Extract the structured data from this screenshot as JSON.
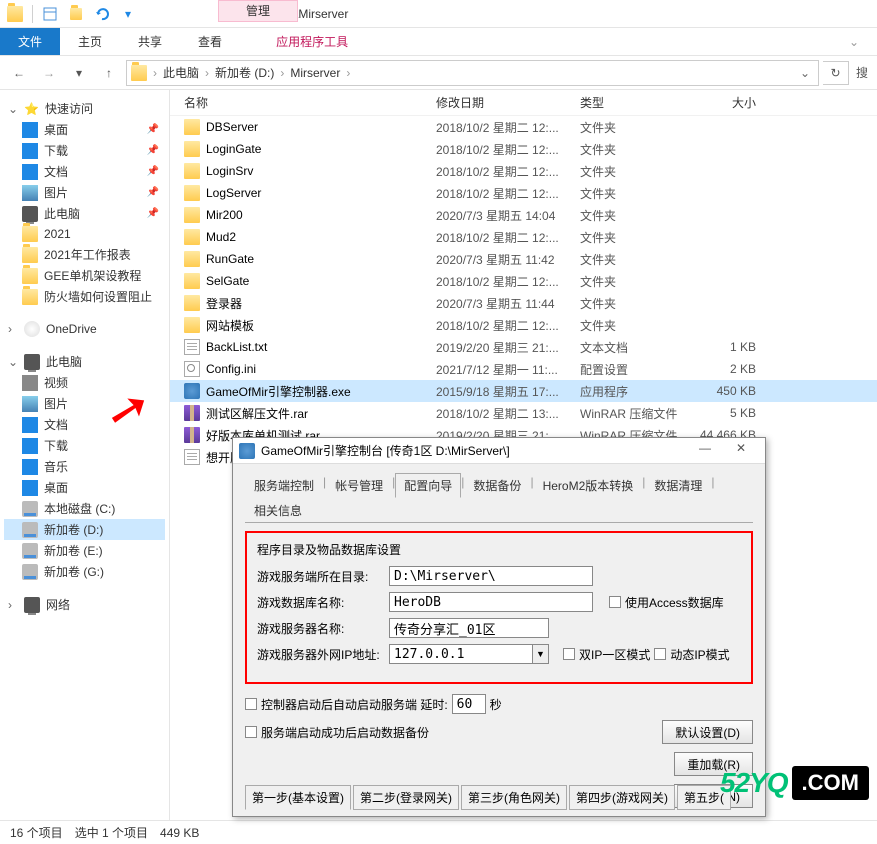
{
  "window": {
    "path_display": "D:\\Mirserver",
    "manage_tab": "管理"
  },
  "ribbon": {
    "file": "文件",
    "home": "主页",
    "share": "共享",
    "view": "查看",
    "apptools": "应用程序工具"
  },
  "breadcrumb": {
    "pc": "此电脑",
    "drive": "新加卷 (D:)",
    "folder": "Mirserver"
  },
  "search_placeholder": "搜",
  "columns": {
    "name": "名称",
    "date": "修改日期",
    "type": "类型",
    "size": "大小"
  },
  "sidebar": {
    "quick": {
      "label": "快速访问",
      "items": [
        {
          "label": "桌面",
          "icon": "blue",
          "pin": true
        },
        {
          "label": "下载",
          "icon": "blue",
          "pin": true
        },
        {
          "label": "文档",
          "icon": "blue",
          "pin": true
        },
        {
          "label": "图片",
          "icon": "pic",
          "pin": true
        },
        {
          "label": "此电脑",
          "icon": "pc",
          "pin": true
        },
        {
          "label": "2021",
          "icon": "folder"
        },
        {
          "label": "2021年工作报表",
          "icon": "folder"
        },
        {
          "label": "GEE单机架设教程",
          "icon": "folder"
        },
        {
          "label": "防火墙如何设置阻止",
          "icon": "folder"
        }
      ]
    },
    "onedrive": {
      "label": "OneDrive"
    },
    "thispc": {
      "label": "此电脑",
      "items": [
        {
          "label": "视频",
          "icon": "grey"
        },
        {
          "label": "图片",
          "icon": "pic"
        },
        {
          "label": "文档",
          "icon": "blue"
        },
        {
          "label": "下载",
          "icon": "blue"
        },
        {
          "label": "音乐",
          "icon": "blue"
        },
        {
          "label": "桌面",
          "icon": "blue"
        },
        {
          "label": "本地磁盘 (C:)",
          "icon": "disk"
        },
        {
          "label": "新加卷 (D:)",
          "icon": "disk",
          "sel": true
        },
        {
          "label": "新加卷 (E:)",
          "icon": "disk"
        },
        {
          "label": "新加卷 (G:)",
          "icon": "disk"
        }
      ]
    },
    "network": {
      "label": "网络"
    }
  },
  "files": [
    {
      "name": "DBServer",
      "date": "2018/10/2 星期二 12:...",
      "type": "文件夹",
      "size": "",
      "icon": "folder"
    },
    {
      "name": "LoginGate",
      "date": "2018/10/2 星期二 12:...",
      "type": "文件夹",
      "size": "",
      "icon": "folder"
    },
    {
      "name": "LoginSrv",
      "date": "2018/10/2 星期二 12:...",
      "type": "文件夹",
      "size": "",
      "icon": "folder"
    },
    {
      "name": "LogServer",
      "date": "2018/10/2 星期二 12:...",
      "type": "文件夹",
      "size": "",
      "icon": "folder"
    },
    {
      "name": "Mir200",
      "date": "2020/7/3 星期五 14:04",
      "type": "文件夹",
      "size": "",
      "icon": "folder"
    },
    {
      "name": "Mud2",
      "date": "2018/10/2 星期二 12:...",
      "type": "文件夹",
      "size": "",
      "icon": "folder"
    },
    {
      "name": "RunGate",
      "date": "2020/7/3 星期五 11:42",
      "type": "文件夹",
      "size": "",
      "icon": "folder"
    },
    {
      "name": "SelGate",
      "date": "2018/10/2 星期二 12:...",
      "type": "文件夹",
      "size": "",
      "icon": "folder"
    },
    {
      "name": "登录器",
      "date": "2020/7/3 星期五 11:44",
      "type": "文件夹",
      "size": "",
      "icon": "folder"
    },
    {
      "name": "网站模板",
      "date": "2018/10/2 星期二 12:...",
      "type": "文件夹",
      "size": "",
      "icon": "folder"
    },
    {
      "name": "BackList.txt",
      "date": "2019/2/20 星期三 21:...",
      "type": "文本文档",
      "size": "1 KB",
      "icon": "txt"
    },
    {
      "name": "Config.ini",
      "date": "2021/7/12 星期一 11:...",
      "type": "配置设置",
      "size": "2 KB",
      "icon": "ini"
    },
    {
      "name": "GameOfMir引擎控制器.exe",
      "date": "2015/9/18 星期五 17:...",
      "type": "应用程序",
      "size": "450 KB",
      "icon": "exe",
      "sel": true
    },
    {
      "name": "测试区解压文件.rar",
      "date": "2018/10/2 星期二 13:...",
      "type": "WinRAR 压缩文件",
      "size": "5 KB",
      "icon": "rar"
    },
    {
      "name": "好版本库单机测试.rar",
      "date": "2019/2/20 星期三 21:...",
      "type": "WinRAR 压缩文件",
      "size": "44 466 KB",
      "icon": "rar"
    },
    {
      "name": "想开服",
      "date": "",
      "type": "",
      "size": "",
      "icon": "txt"
    }
  ],
  "dialog": {
    "title": "GameOfMir引擎控制台 [传奇1区 D:\\MirServer\\]",
    "tabs": [
      "服务端控制",
      "帐号管理",
      "配置向导",
      "数据备份",
      "HeroM2版本转换",
      "数据清理",
      "相关信息"
    ],
    "active_tab": 2,
    "group_title": "程序目录及物品数据库设置",
    "fields": {
      "dir_label": "游戏服务端所在目录:",
      "dir_value": "D:\\Mirserver\\",
      "db_label": "游戏数据库名称:",
      "db_value": "HeroDB",
      "db_chk": "使用Access数据库",
      "srv_label": "游戏服务器名称:",
      "srv_value": "传奇分享汇_01区",
      "ip_label": "游戏服务器外网IP地址:",
      "ip_value": "127.0.0.1",
      "ip_chk1": "双IP一区模式",
      "ip_chk2": "动态IP模式"
    },
    "auto1": "控制器启动后自动启动服务端   延时:",
    "auto1_val": "60",
    "auto1_unit": "秒",
    "auto2": "服务端启动成功后启动数据备份",
    "btn_default": "默认设置(D)",
    "btn_reload": "重加载(R)",
    "btn_next": "下一步(N)",
    "steps": [
      "第一步(基本设置)",
      "第二步(登录网关)",
      "第三步(角色网关)",
      "第四步(游戏网关)",
      "第五步("
    ]
  },
  "statusbar": {
    "count": "16 个项目",
    "selection": "选中 1 个项目",
    "size": "449 KB"
  },
  "watermark": {
    "a": "52YQ",
    "b": ".COM"
  }
}
